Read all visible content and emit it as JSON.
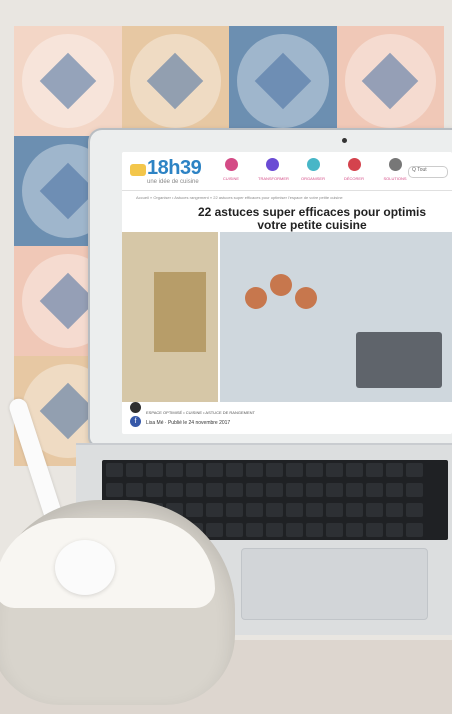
{
  "site": {
    "logo": "18h39",
    "tagline": "une idée de cuisine",
    "nav": [
      {
        "label": "CUISINE",
        "color": "#d44b86"
      },
      {
        "label": "TRANSFORMER",
        "color": "#6a4bd4"
      },
      {
        "label": "ORGANISER",
        "color": "#47b6c7"
      },
      {
        "label": "DÉCORER",
        "color": "#d4434d"
      },
      {
        "label": "SOLUTIONS",
        "color": "#777777"
      }
    ],
    "search_placeholder": "Q Tout"
  },
  "breadcrumb": "Accueil » Organiser • Astuces rangement » 22 astuces super efficaces pour optimiser l'espace de votre petite cuisine",
  "article": {
    "title_line1": "22 astuces super efficaces pour optimis",
    "title_line2": "votre petite cuisine",
    "categories": "ESPACE OPTIMISÉ • CUISINE • ASTUCE DE RANGEMENT",
    "byline": "Lisa Mé · Publié le 24 novembre 2017"
  }
}
